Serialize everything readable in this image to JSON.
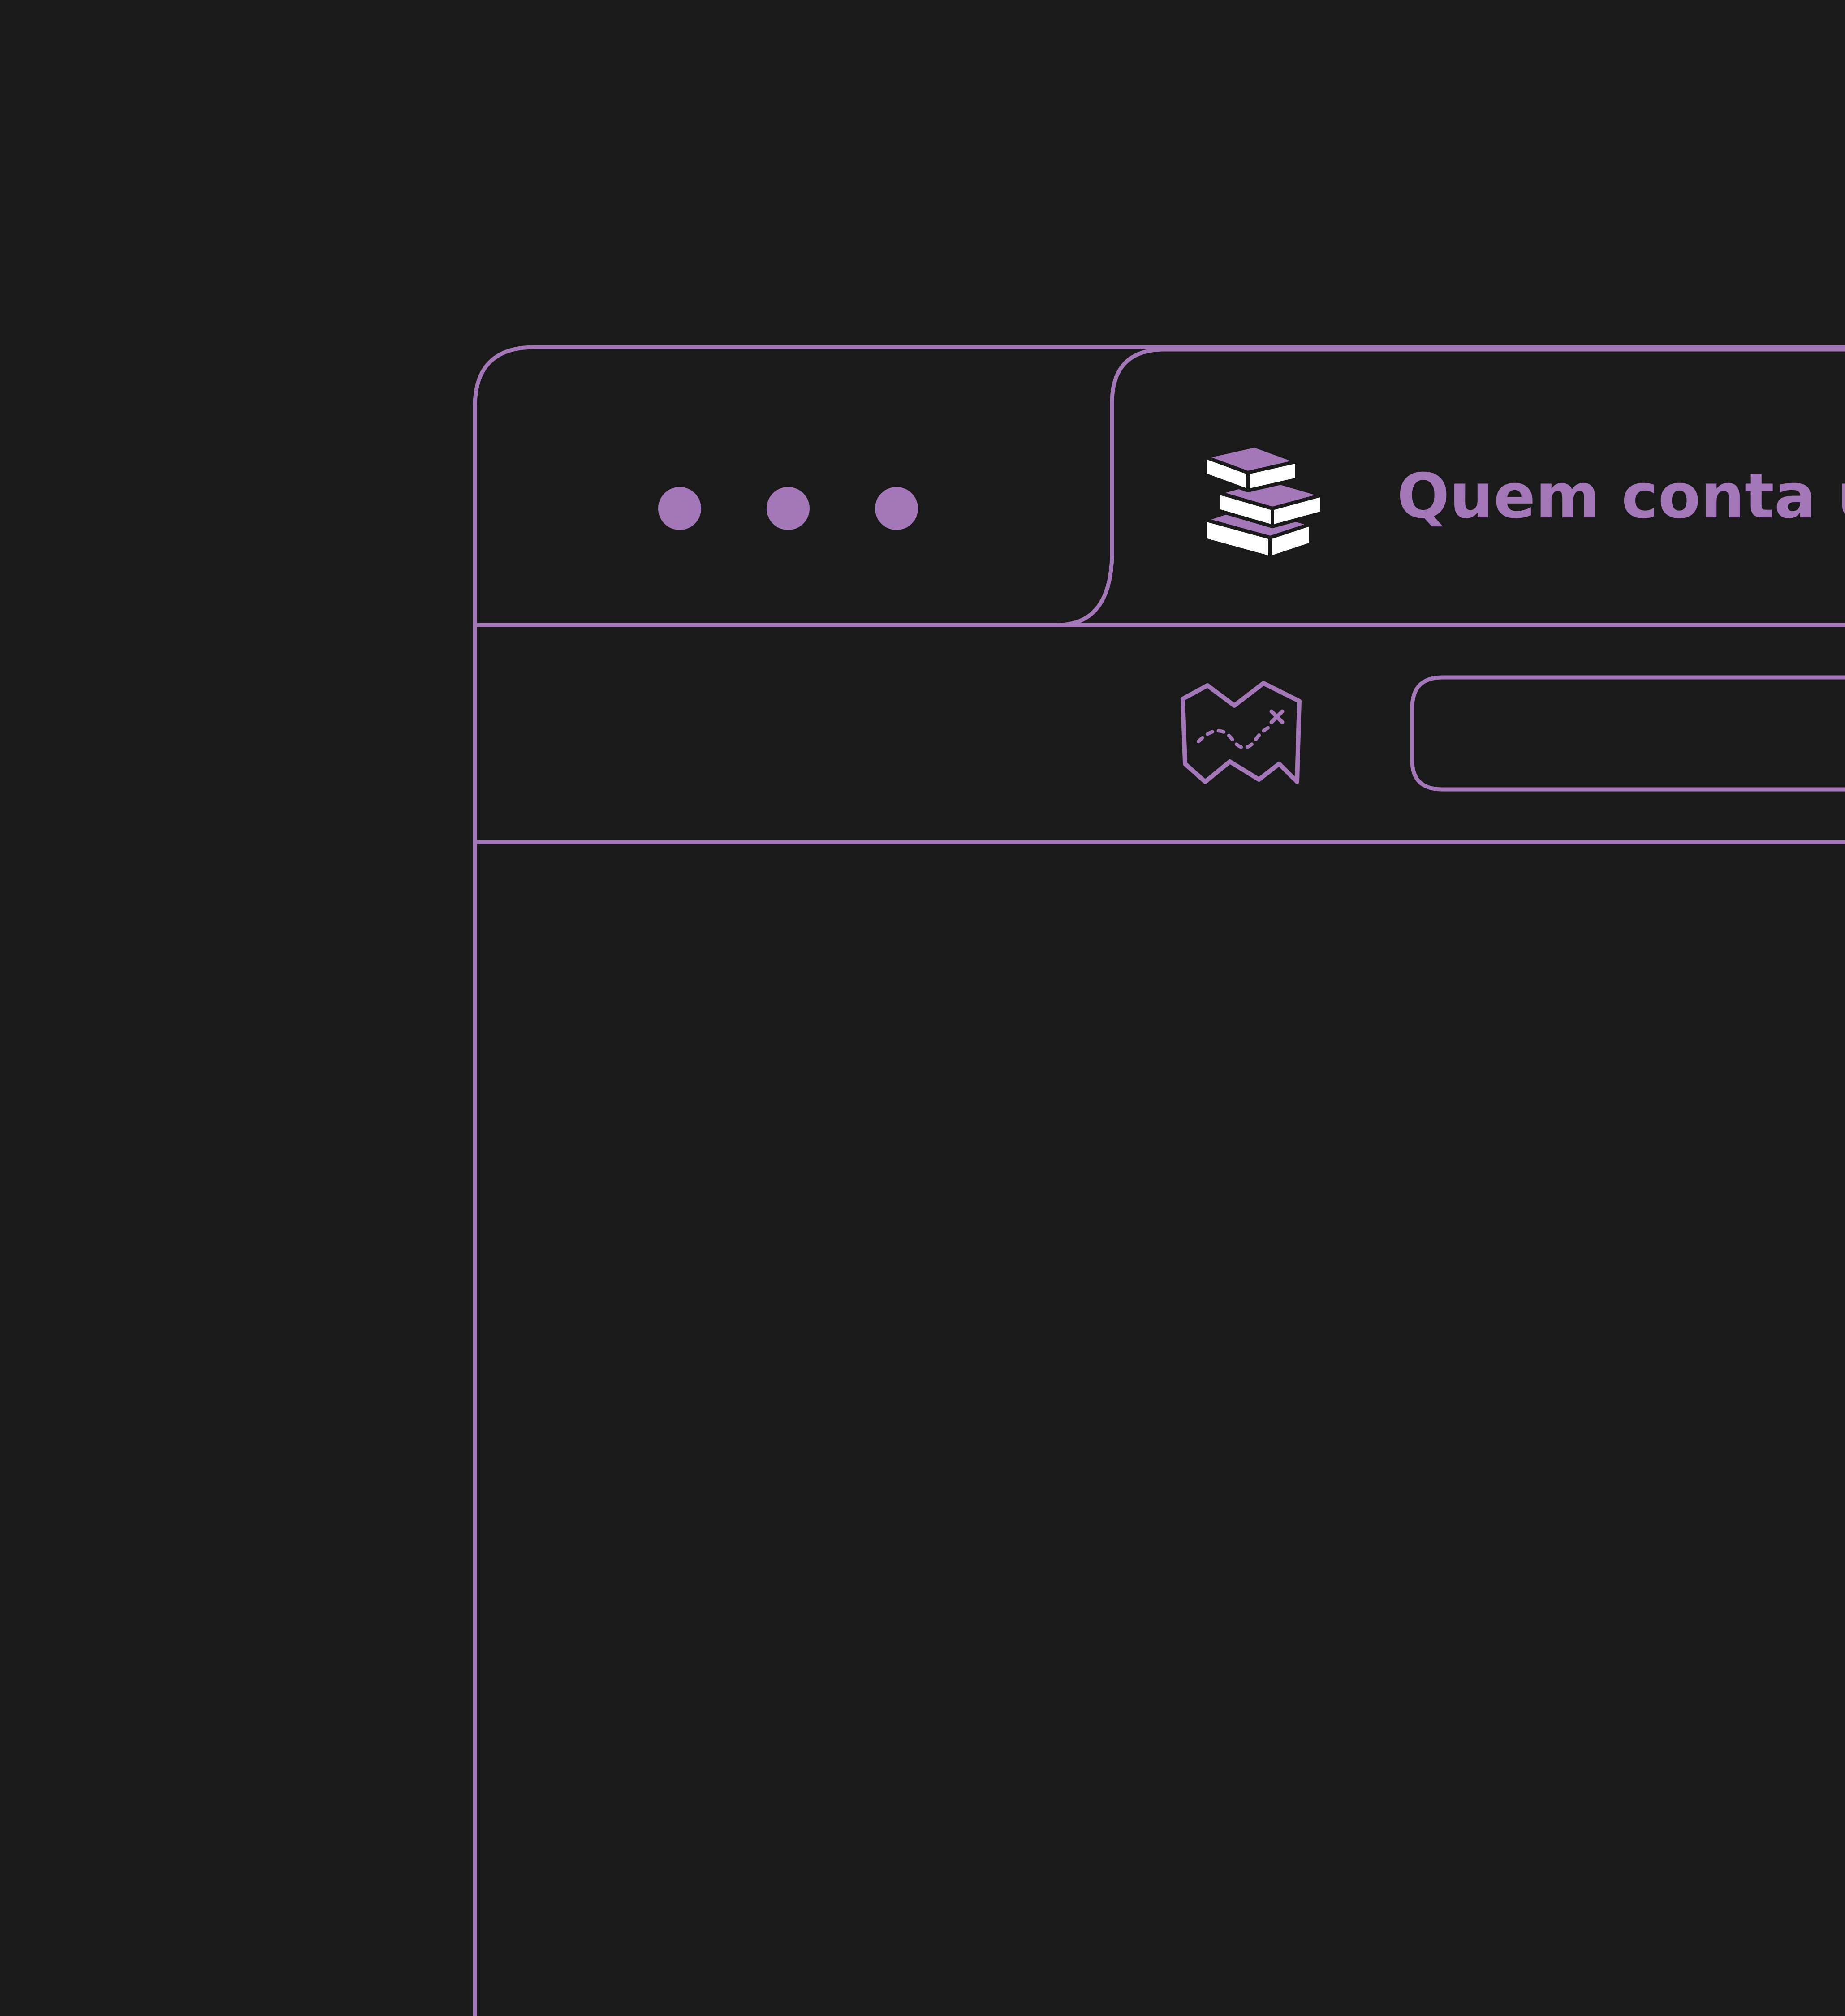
{
  "browser": {
    "window_controls": [
      "dot",
      "dot",
      "dot"
    ],
    "tab": {
      "title": "Quem conta um c",
      "favicon": "stacked-books-icon"
    },
    "address_bar": {
      "icon": "treasure-map-icon",
      "value": ""
    }
  },
  "colors": {
    "background": "#1b1a1b",
    "accent": "#a477b9",
    "book_light": "#ffffff"
  }
}
